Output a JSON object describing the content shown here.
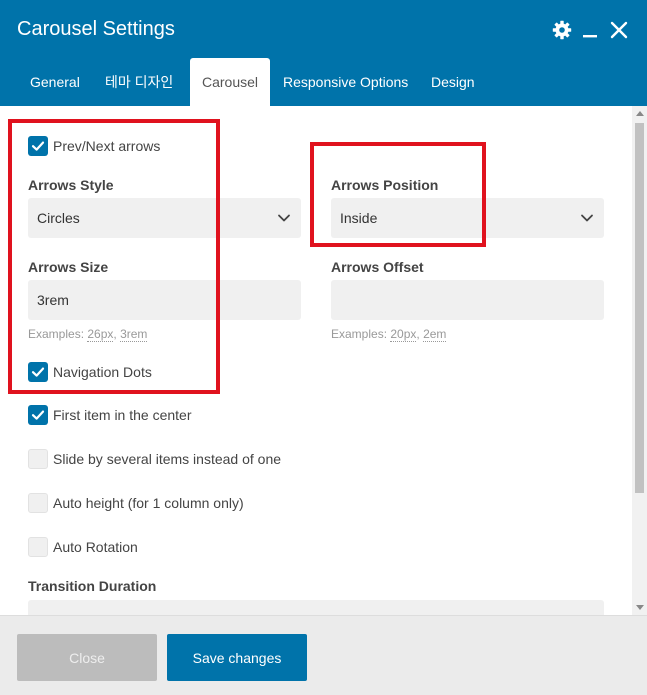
{
  "window": {
    "title": "Carousel Settings",
    "icons": [
      "gear-icon",
      "minimize-icon",
      "close-icon"
    ]
  },
  "tabs": [
    {
      "label": "General",
      "active": false
    },
    {
      "label": "테마 디자인",
      "active": false
    },
    {
      "label": "Carousel",
      "active": true
    },
    {
      "label": "Responsive Options",
      "active": false
    },
    {
      "label": "Design",
      "active": false
    }
  ],
  "settings": {
    "prev_next": {
      "label": "Prev/Next arrows",
      "checked": true
    },
    "arrows_style": {
      "label": "Arrows Style",
      "value": "Circles"
    },
    "arrows_position": {
      "label": "Arrows Position",
      "value": "Inside"
    },
    "arrows_size": {
      "label": "Arrows Size",
      "value": "3rem",
      "hint_prefix": "Examples: ",
      "hint_a": "26px",
      "hint_sep": ", ",
      "hint_b": "3rem"
    },
    "arrows_offset": {
      "label": "Arrows Offset",
      "value": "",
      "hint_prefix": "Examples: ",
      "hint_a": "20px",
      "hint_sep": ", ",
      "hint_b": "2em"
    },
    "nav_dots": {
      "label": "Navigation Dots",
      "checked": true
    },
    "center_item": {
      "label": "First item in the center",
      "checked": true
    },
    "slide_several": {
      "label": "Slide by several items instead of one",
      "checked": false
    },
    "auto_height": {
      "label": "Auto height (for 1 column only)",
      "checked": false
    },
    "auto_rotation": {
      "label": "Auto Rotation",
      "checked": false
    },
    "transition_duration": {
      "label": "Transition Duration"
    }
  },
  "footer": {
    "close_label": "Close",
    "save_label": "Save changes"
  },
  "colors": {
    "header": "#0073aa",
    "accent": "#0073aa",
    "highlight": "#e0121e"
  }
}
